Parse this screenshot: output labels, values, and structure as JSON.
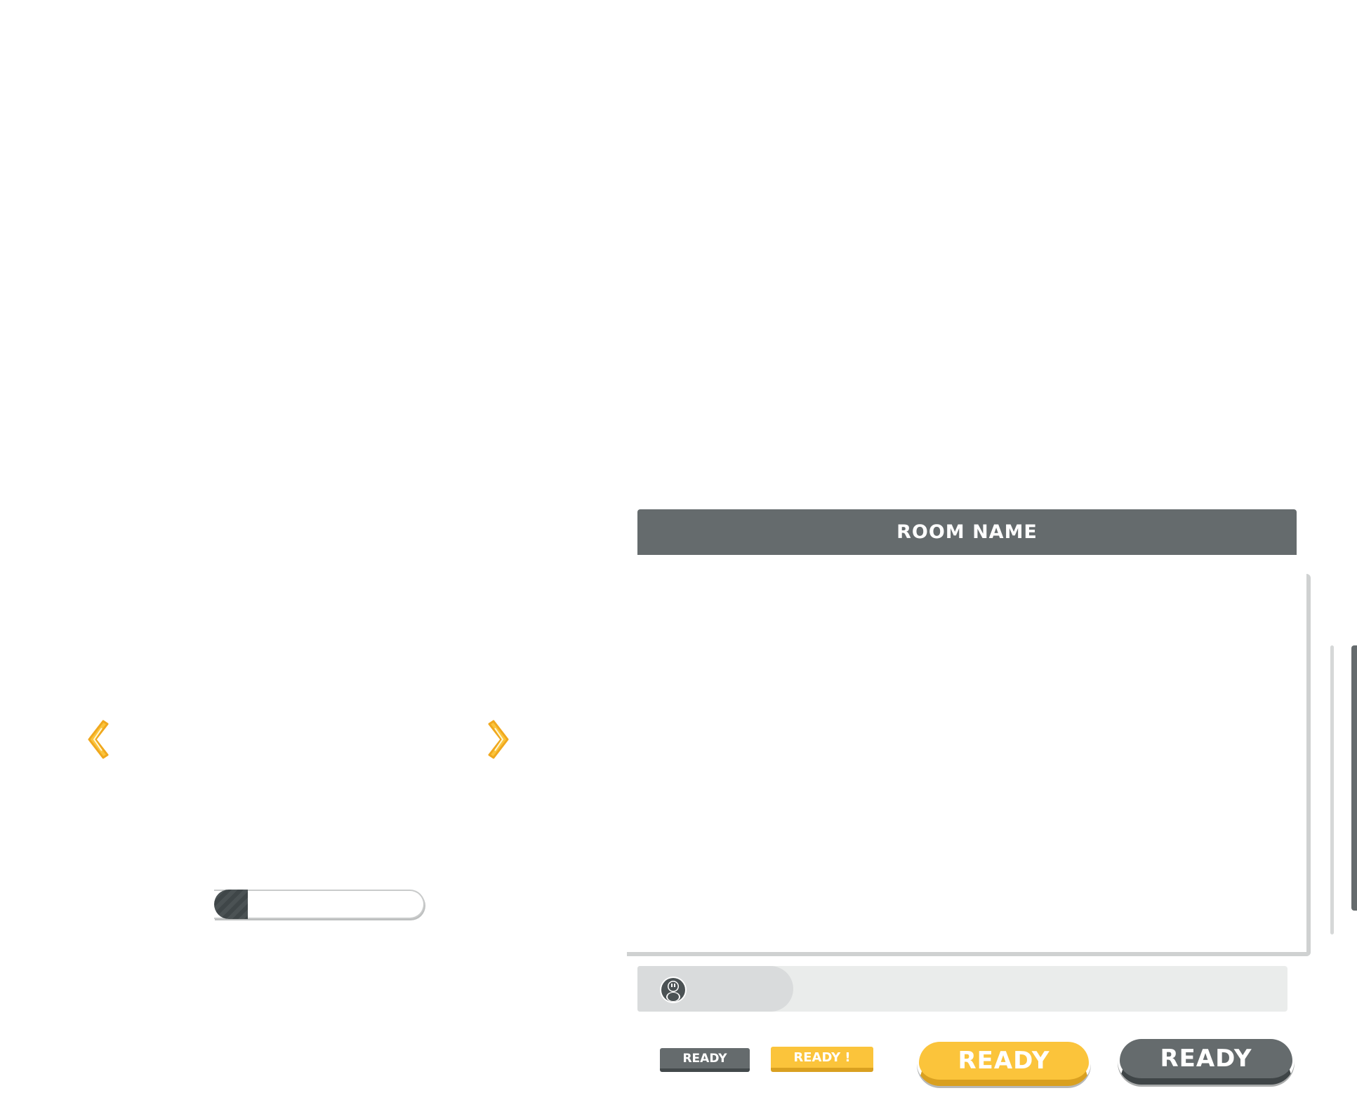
{
  "room": {
    "title": "ROOM NAME"
  },
  "chat": {
    "avatar_icon": "penguin-avatar-icon"
  },
  "carousel": {
    "prev_icon": "double-chevron-left-icon",
    "next_icon": "double-chevron-right-icon"
  },
  "slider": {
    "level_fraction": 0.16
  },
  "buttons": {
    "ready_small_grey": "READY",
    "ready_small_yellow": "READY !",
    "ready_large_yellow": "READY",
    "ready_large_grey": "READY"
  },
  "colors": {
    "accent_yellow": "#fbc43b",
    "header_grey": "#656b6d",
    "chat_bar": "#eaeceb"
  }
}
